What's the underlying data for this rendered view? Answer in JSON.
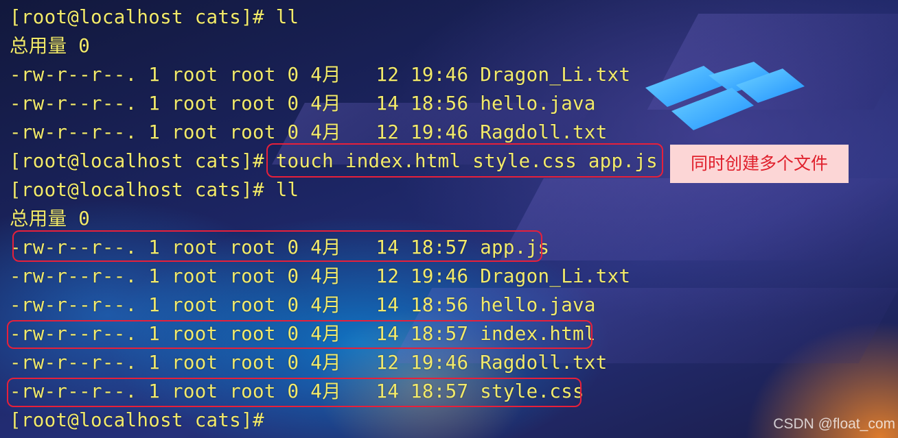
{
  "terminal": {
    "lines": [
      "[root@localhost cats]# ll",
      "总用量 0",
      "-rw-r--r--. 1 root root 0 4月   12 19:46 Dragon_Li.txt",
      "-rw-r--r--. 1 root root 0 4月   14 18:56 hello.java",
      "-rw-r--r--. 1 root root 0 4月   12 19:46 Ragdoll.txt",
      "[root@localhost cats]# touch index.html style.css app.js",
      "[root@localhost cats]# ll",
      "总用量 0",
      "-rw-r--r--. 1 root root 0 4月   14 18:57 app.js",
      "-rw-r--r--. 1 root root 0 4月   12 19:46 Dragon_Li.txt",
      "-rw-r--r--. 1 root root 0 4月   14 18:56 hello.java",
      "-rw-r--r--. 1 root root 0 4月   14 18:57 index.html",
      "-rw-r--r--. 1 root root 0 4月   12 19:46 Ragdoll.txt",
      "-rw-r--r--. 1 root root 0 4月   14 18:57 style.css",
      "[root@localhost cats]#"
    ],
    "text_color": "#f2ea6a"
  },
  "annotation": {
    "text": "同时创建多个文件",
    "text_color": "#e0202c",
    "background": "#fcd6d6"
  },
  "highlight_color": "#e8203a",
  "watermark": "CSDN @float_com",
  "icons": {
    "logo": "windows-logo-icon"
  }
}
